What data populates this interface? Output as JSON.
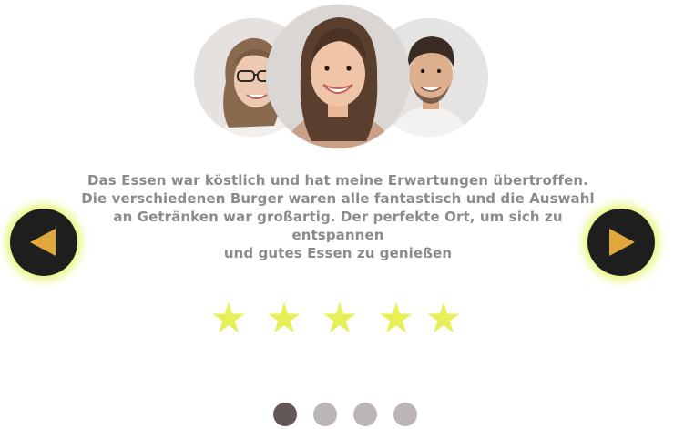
{
  "testimonial": {
    "lines": [
      "Das Essen war köstlich und hat meine Erwartungen übertroffen.",
      "Die verschiedenen Burger waren alle fantastisch und die Auswahl",
      "an Getränken war großartig. Der perfekte Ort, um sich zu",
      "entspannen",
      "und gutes Essen zu genießen"
    ]
  },
  "rating": {
    "value": 5,
    "max": 5,
    "star_glyph": "★",
    "star_color": "#e8f057"
  },
  "pagination": {
    "count": 4,
    "active_index": 0,
    "active_color": "#625858",
    "inactive_color": "#bcb5b5"
  },
  "nav": {
    "prev_icon": "play-left-icon",
    "next_icon": "play-right-icon",
    "arrow_color": "#e2a73a",
    "button_color": "#1e1e1e",
    "glow_color": "#e2f050"
  },
  "avatars": [
    {
      "name": "avatar-woman-glasses"
    },
    {
      "name": "avatar-woman-smiling"
    },
    {
      "name": "avatar-man-smiling"
    }
  ],
  "colors": {
    "text": "#8e8a8c",
    "background": "#ffffff"
  }
}
